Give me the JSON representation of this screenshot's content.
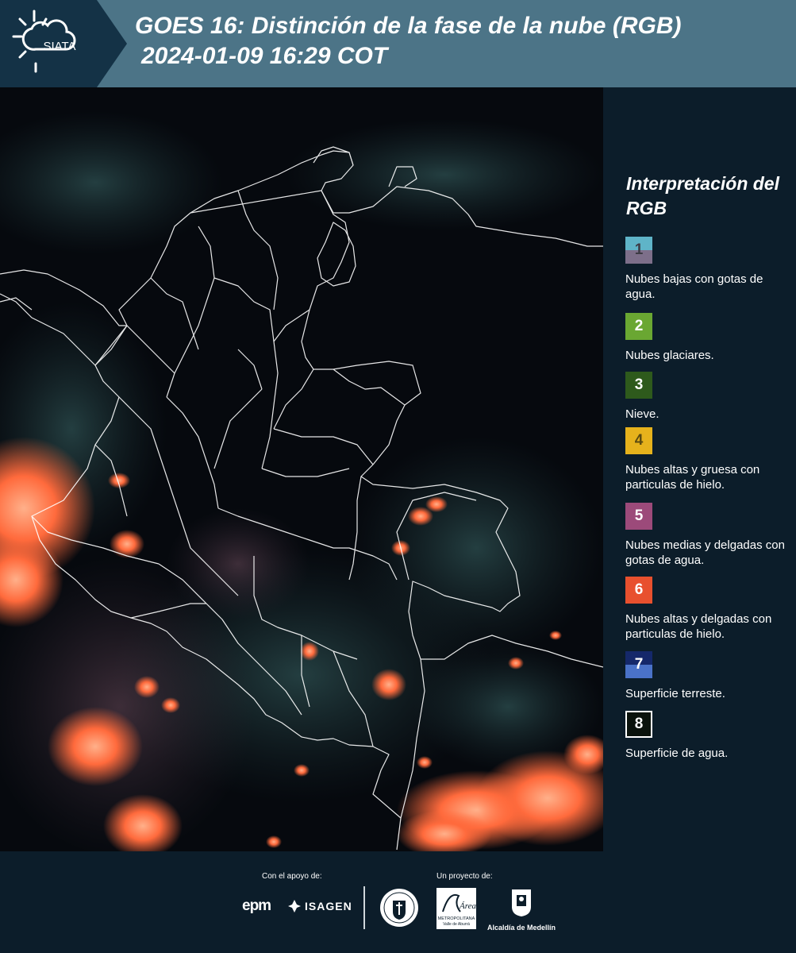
{
  "header": {
    "logo_text": "SIATA",
    "title_line1": "GOES 16: Distinción de la fase de la nube (RGB)",
    "title_line2": "2024-01-09 16:29 COT"
  },
  "map": {
    "description_icon": "satellite-rgb-map",
    "colors": {
      "background": "#05080d",
      "cloud_orange": "#ff6a3c",
      "border": "#ffffff"
    }
  },
  "legend": {
    "title": "Interpretación del RGB",
    "items": [
      {
        "number": "1",
        "label": "Nubes bajas con gotas de agua.",
        "color_top": "#5fb4c8",
        "color_bottom": "#7d6f8a",
        "text_color": "#3d3b45"
      },
      {
        "number": "2",
        "label": "Nubes glaciares.",
        "color_top": "#6aa732",
        "color_bottom": "#6aa732",
        "text_color": "#ffffff"
      },
      {
        "number": "3",
        "label": "Nieve.",
        "color_top": "#2e5a1c",
        "color_bottom": "#2e5a1c",
        "text_color": "#ffffff"
      },
      {
        "number": "4",
        "label": "Nubes altas y gruesa con particulas de hielo.",
        "color_top": "#e6b21c",
        "color_bottom": "#e6b21c",
        "text_color": "#5a4a10"
      },
      {
        "number": "5",
        "label": "Nubes medias y delgadas con gotas de agua.",
        "color_top": "#9c4a7a",
        "color_bottom": "#9c4a7a",
        "text_color": "#ffffff"
      },
      {
        "number": "6",
        "label": "Nubes altas y delgadas con particulas de hielo.",
        "color_top": "#e8502e",
        "color_bottom": "#e8502e",
        "text_color": "#ffffff"
      },
      {
        "number": "7",
        "label": "Superficie terreste.",
        "color_top": "#15286a",
        "color_bottom": "#4a72c8",
        "text_color": "#ffffff"
      },
      {
        "number": "8",
        "label": "Superficie de agua.",
        "color_top": "#0a120c",
        "color_bottom": "#0a120c",
        "text_color": "#ffffff"
      }
    ]
  },
  "footer": {
    "support_label": "Con el apoyo de:",
    "project_label": "Un proyecto de:",
    "epm_text": "epm",
    "isagen_text": "ISAGEN",
    "amva_text": "METROPOLITANA",
    "amva_sub": "Valle de Aburrá",
    "amva_script": "Área",
    "alcaldia_text": "Alcaldía de Medellín"
  }
}
